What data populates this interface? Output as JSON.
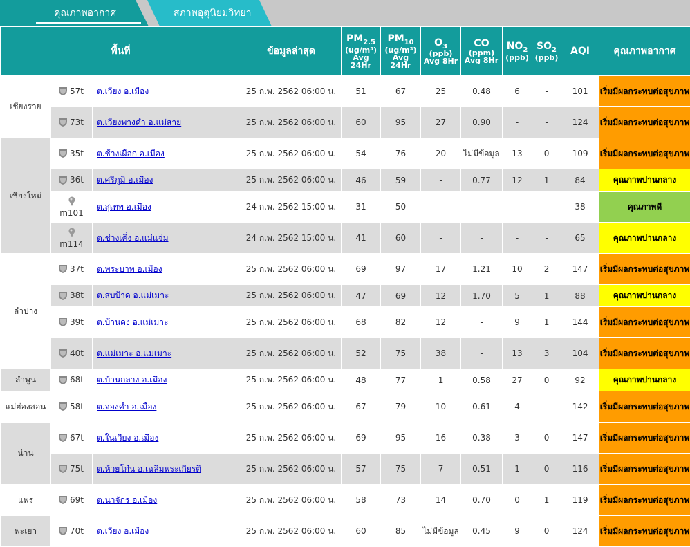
{
  "tabs": [
    {
      "label": "คุณภาพอากาศ",
      "active": true
    },
    {
      "label": "สภาพอุตุนิยมวิทยา",
      "active": false
    }
  ],
  "headers": {
    "area": "พื้นที่",
    "latest": "ข้อมูลล่าสุด",
    "pm25": {
      "name": "PM",
      "subname": "2.5",
      "unit": "(ug/m³)",
      "avg": "Avg",
      "period": "24Hr"
    },
    "pm10": {
      "name": "PM",
      "subname": "10",
      "unit": "(ug/m³)",
      "avg": "Avg",
      "period": "24Hr"
    },
    "o3": {
      "name": "O",
      "subname": "3",
      "unit": "(ppb)",
      "avg": "Avg 8Hr"
    },
    "co": {
      "name": "CO",
      "unit": "(ppm)",
      "avg": "Avg 8Hr"
    },
    "no2": {
      "name": "NO",
      "subname": "2",
      "unit": "(ppb)"
    },
    "so2": {
      "name": "SO",
      "subname": "2",
      "unit": "(ppb)"
    },
    "aqi": "AQI",
    "quality": "คุณภาพอากาศ"
  },
  "colors": {
    "header": "#139c9c",
    "orange": "#ff9c00",
    "yellow": "#ffff00",
    "green": "#92d050"
  },
  "provinces": [
    {
      "name": "เชียงราย",
      "rows": [
        {
          "id": "57t",
          "icon": "shield",
          "site": "ต.เวียง อ.เมือง",
          "time": "25 ก.พ. 2562 06:00 น.",
          "pm25": "51",
          "pm10": "67",
          "o3": "25",
          "co": "0.48",
          "no2": "6",
          "so2": "-",
          "aqi": "101",
          "quality": "เริ่มมีผลกระทบต่อสุขภาพ",
          "level": "orange"
        },
        {
          "id": "73t",
          "icon": "shield",
          "site": "ต.เวียงพางคำ อ.แม่สาย",
          "time": "25 ก.พ. 2562 06:00 น.",
          "pm25": "60",
          "pm10": "95",
          "o3": "27",
          "co": "0.90",
          "no2": "-",
          "so2": "-",
          "aqi": "124",
          "quality": "เริ่มมีผลกระทบต่อสุขภาพ",
          "level": "orange"
        }
      ]
    },
    {
      "name": "เชียงใหม่",
      "rows": [
        {
          "id": "35t",
          "icon": "shield",
          "site": "ต.ช้างเผือก อ.เมือง",
          "time": "25 ก.พ. 2562 06:00 น.",
          "pm25": "54",
          "pm10": "76",
          "o3": "20",
          "co": "ไม่มีข้อมูล",
          "no2": "13",
          "so2": "0",
          "aqi": "109",
          "quality": "เริ่มมีผลกระทบต่อสุขภาพ",
          "level": "orange"
        },
        {
          "id": "36t",
          "icon": "shield",
          "site": "ต.ศรีภูมิ อ.เมือง",
          "time": "25 ก.พ. 2562 06:00 น.",
          "pm25": "46",
          "pm10": "59",
          "o3": "-",
          "co": "0.77",
          "no2": "12",
          "so2": "1",
          "aqi": "84",
          "quality": "คุณภาพปานกลาง",
          "level": "yellow"
        },
        {
          "id": "m101",
          "icon": "pin",
          "site": "ต.สุเทพ อ.เมือง",
          "time": "24 ก.พ. 2562 15:00 น.",
          "pm25": "31",
          "pm10": "50",
          "o3": "-",
          "co": "-",
          "no2": "-",
          "so2": "-",
          "aqi": "38",
          "quality": "คุณภาพดี",
          "level": "green"
        },
        {
          "id": "m114",
          "icon": "pin",
          "site": "ต.ช่างเคิ่ง อ.แม่แจ่ม",
          "time": "24 ก.พ. 2562 15:00 น.",
          "pm25": "41",
          "pm10": "60",
          "o3": "-",
          "co": "-",
          "no2": "-",
          "so2": "-",
          "aqi": "65",
          "quality": "คุณภาพปานกลาง",
          "level": "yellow"
        }
      ]
    },
    {
      "name": "ลำปาง",
      "rows": [
        {
          "id": "37t",
          "icon": "shield",
          "site": "ต.พระบาท อ.เมือง",
          "time": "25 ก.พ. 2562 06:00 น.",
          "pm25": "69",
          "pm10": "97",
          "o3": "17",
          "co": "1.21",
          "no2": "10",
          "so2": "2",
          "aqi": "147",
          "quality": "เริ่มมีผลกระทบต่อสุขภาพ",
          "level": "orange"
        },
        {
          "id": "38t",
          "icon": "shield",
          "site": "ต.สบป้าด อ.แม่เมาะ",
          "time": "25 ก.พ. 2562 06:00 น.",
          "pm25": "47",
          "pm10": "69",
          "o3": "12",
          "co": "1.70",
          "no2": "5",
          "so2": "1",
          "aqi": "88",
          "quality": "คุณภาพปานกลาง",
          "level": "yellow"
        },
        {
          "id": "39t",
          "icon": "shield",
          "site": "ต.บ้านดง อ.แม่เมาะ",
          "time": "25 ก.พ. 2562 06:00 น.",
          "pm25": "68",
          "pm10": "82",
          "o3": "12",
          "co": "-",
          "no2": "9",
          "so2": "1",
          "aqi": "144",
          "quality": "เริ่มมีผลกระทบต่อสุขภาพ",
          "level": "orange"
        },
        {
          "id": "40t",
          "icon": "shield",
          "site": "ต.แม่เมาะ อ.แม่เมาะ",
          "time": "25 ก.พ. 2562 06:00 น.",
          "pm25": "52",
          "pm10": "75",
          "o3": "38",
          "co": "-",
          "no2": "13",
          "so2": "3",
          "aqi": "104",
          "quality": "เริ่มมีผลกระทบต่อสุขภาพ",
          "level": "orange"
        }
      ]
    },
    {
      "name": "ลำพูน",
      "rows": [
        {
          "id": "68t",
          "icon": "shield",
          "site": "ต.บ้านกลาง อ.เมือง",
          "time": "25 ก.พ. 2562 06:00 น.",
          "pm25": "48",
          "pm10": "77",
          "o3": "1",
          "co": "0.58",
          "no2": "27",
          "so2": "0",
          "aqi": "92",
          "quality": "คุณภาพปานกลาง",
          "level": "yellow"
        }
      ]
    },
    {
      "name": "แม่ฮ่องสอน",
      "rows": [
        {
          "id": "58t",
          "icon": "shield",
          "site": "ต.จองคำ อ.เมือง",
          "time": "25 ก.พ. 2562 06:00 น.",
          "pm25": "67",
          "pm10": "79",
          "o3": "10",
          "co": "0.61",
          "no2": "4",
          "so2": "-",
          "aqi": "142",
          "quality": "เริ่มมีผลกระทบต่อสุขภาพ",
          "level": "orange"
        }
      ]
    },
    {
      "name": "น่าน",
      "rows": [
        {
          "id": "67t",
          "icon": "shield",
          "site": "ต.ในเวียง อ.เมือง",
          "time": "25 ก.พ. 2562 06:00 น.",
          "pm25": "69",
          "pm10": "95",
          "o3": "16",
          "co": "0.38",
          "no2": "3",
          "so2": "0",
          "aqi": "147",
          "quality": "เริ่มมีผลกระทบต่อสุขภาพ",
          "level": "orange"
        },
        {
          "id": "75t",
          "icon": "shield",
          "site": "ต.ห้วยโก๋น อ.เฉลิมพระเกียรติ",
          "time": "25 ก.พ. 2562 06:00 น.",
          "pm25": "57",
          "pm10": "75",
          "o3": "7",
          "co": "0.51",
          "no2": "1",
          "so2": "0",
          "aqi": "116",
          "quality": "เริ่มมีผลกระทบต่อสุขภาพ",
          "level": "orange"
        }
      ]
    },
    {
      "name": "แพร่",
      "rows": [
        {
          "id": "69t",
          "icon": "shield",
          "site": "ต.นาจักร อ.เมือง",
          "time": "25 ก.พ. 2562 06:00 น.",
          "pm25": "58",
          "pm10": "73",
          "o3": "14",
          "co": "0.70",
          "no2": "0",
          "so2": "1",
          "aqi": "119",
          "quality": "เริ่มมีผลกระทบต่อสุขภาพ",
          "level": "orange"
        }
      ]
    },
    {
      "name": "พะเยา",
      "rows": [
        {
          "id": "70t",
          "icon": "shield",
          "site": "ต.เวียง อ.เมือง",
          "time": "25 ก.พ. 2562 06:00 น.",
          "pm25": "60",
          "pm10": "85",
          "o3": "ไม่มีข้อมูล",
          "co": "0.45",
          "no2": "9",
          "so2": "0",
          "aqi": "124",
          "quality": "เริ่มมีผลกระทบต่อสุขภาพ",
          "level": "orange"
        }
      ]
    }
  ]
}
